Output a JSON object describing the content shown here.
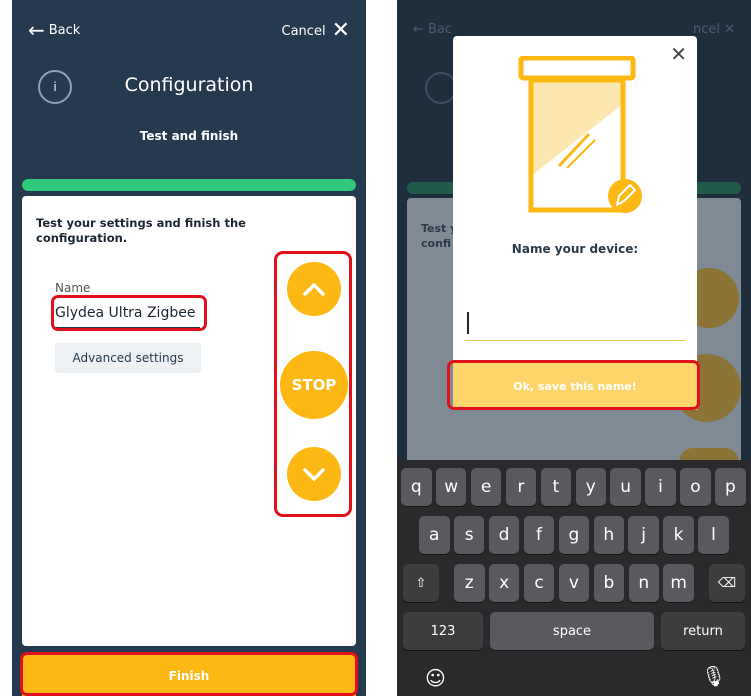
{
  "left_screen": {
    "back_label": "Back",
    "cancel_label": "Cancel",
    "info_label": "i",
    "title": "Configuration",
    "subtitle": "Test and finish",
    "progress_fraction": 1.0,
    "heading": "Test your settings and finish the configuration.",
    "name_label": "Name",
    "name_value": "Glydea Ultra Zigbee",
    "advanced_settings_label": "Advanced settings",
    "stop_label": "STOP",
    "finish_label": "Finish"
  },
  "right_screen": {
    "background": {
      "back_label": "Bac",
      "cancel_label": "ncel",
      "card_text": "Test y\nconfi"
    },
    "modal": {
      "label": "Name your device:",
      "input_value": "",
      "ok_label": "Ok, save this name!"
    },
    "keyboard": {
      "row1": [
        "q",
        "w",
        "e",
        "r",
        "t",
        "y",
        "u",
        "i",
        "o",
        "p"
      ],
      "row2": [
        "a",
        "s",
        "d",
        "f",
        "g",
        "h",
        "j",
        "k",
        "l"
      ],
      "row3": [
        "z",
        "x",
        "c",
        "v",
        "b",
        "n",
        "m"
      ],
      "numbers_label": "123",
      "space_label": "space",
      "return_label": "return"
    }
  },
  "colors": {
    "accent_yellow": "#fdb813",
    "progress_green": "#30c87a",
    "navy": "#263a4f",
    "highlight_red": "#e0111b"
  }
}
